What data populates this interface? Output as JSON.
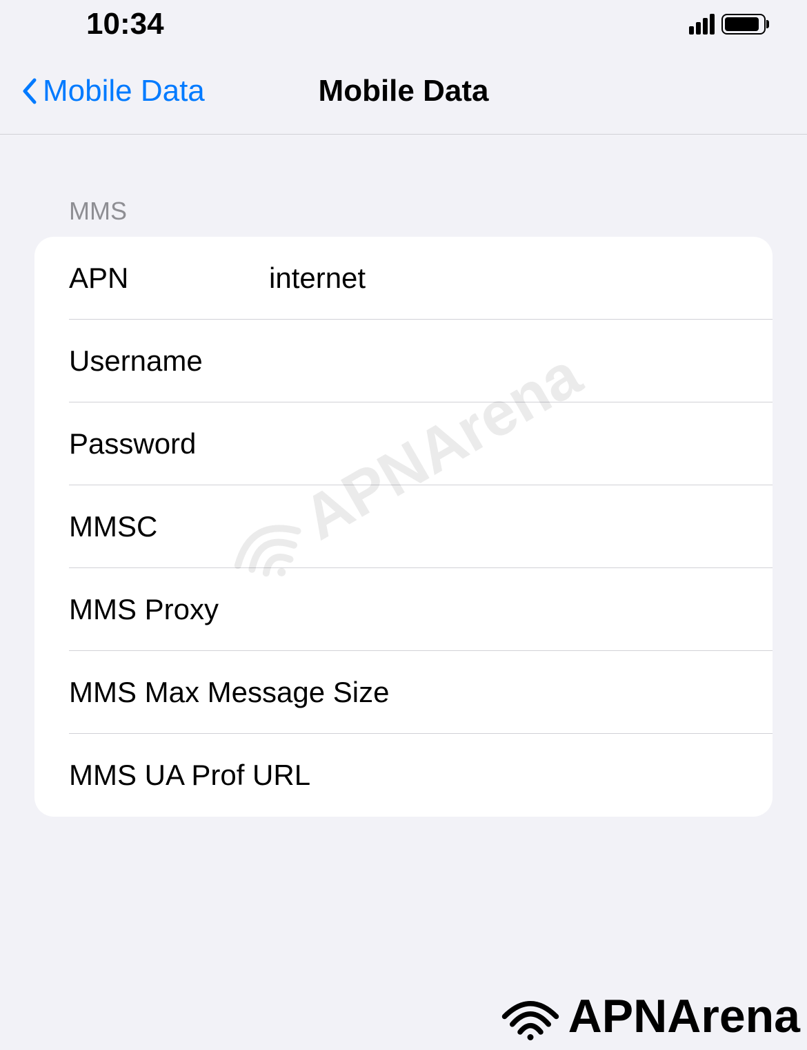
{
  "status_bar": {
    "time": "10:34"
  },
  "nav": {
    "back_label": "Mobile Data",
    "title": "Mobile Data"
  },
  "section": {
    "header": "MMS",
    "fields": {
      "apn": {
        "label": "APN",
        "value": "internet"
      },
      "username": {
        "label": "Username",
        "value": ""
      },
      "password": {
        "label": "Password",
        "value": ""
      },
      "mmsc": {
        "label": "MMSC",
        "value": ""
      },
      "mms_proxy": {
        "label": "MMS Proxy",
        "value": ""
      },
      "mms_max_size": {
        "label": "MMS Max Message Size",
        "value": ""
      },
      "mms_ua_prof_url": {
        "label": "MMS UA Prof URL",
        "value": ""
      }
    }
  },
  "watermark": {
    "text": "APNArena"
  }
}
